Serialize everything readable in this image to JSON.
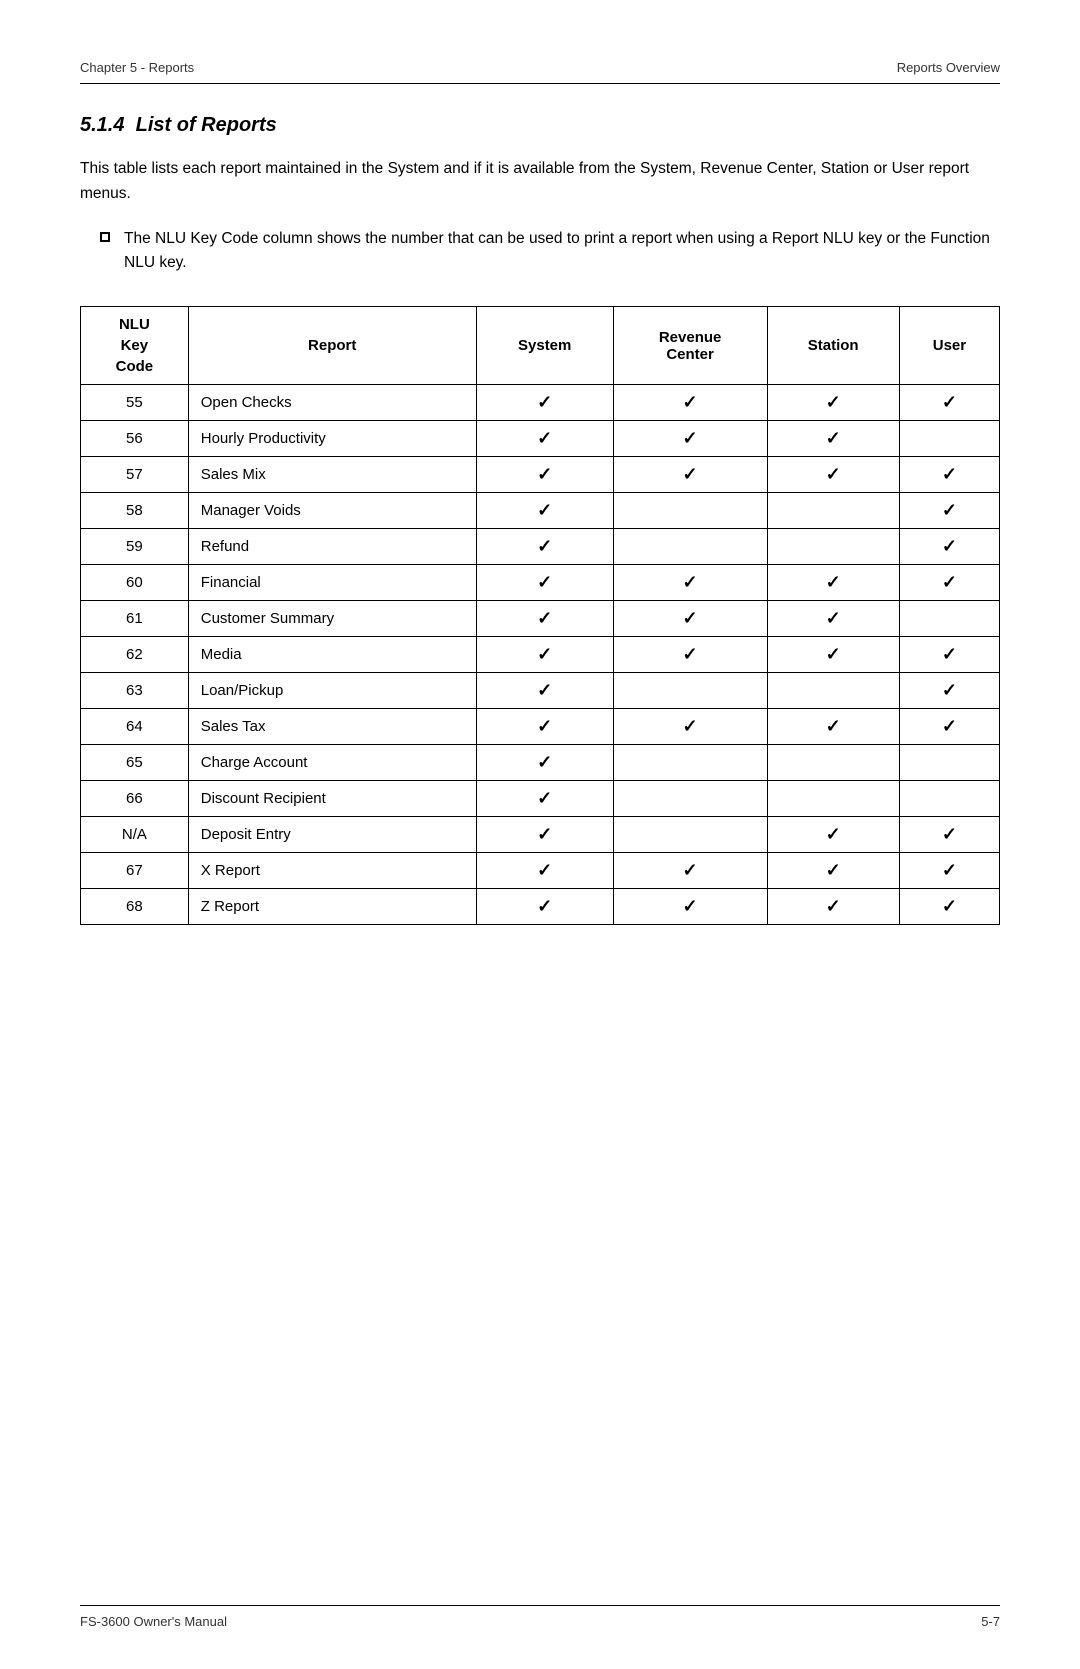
{
  "header": {
    "left": "Chapter 5 - Reports",
    "right": "Reports Overview"
  },
  "section": {
    "number": "5.1.4",
    "title": "List of Reports"
  },
  "body_paragraph": "This table lists each report maintained in the System and if it is available from the System, Revenue Center, Station or User report menus.",
  "bullet_item": "The NLU Key Code column shows the number that can be used to print a report when using a Report NLU key or the Function NLU key.",
  "table": {
    "headers": {
      "nlu_key_code": [
        "NLU",
        "Key",
        "Code"
      ],
      "report": "Report",
      "system": "System",
      "revenue_center": "Revenue Center",
      "station": "Station",
      "user": "User"
    },
    "rows": [
      {
        "code": "55",
        "report": "Open Checks",
        "system": true,
        "revenue": true,
        "station": true,
        "user": true
      },
      {
        "code": "56",
        "report": "Hourly Productivity",
        "system": true,
        "revenue": true,
        "station": true,
        "user": false
      },
      {
        "code": "57",
        "report": "Sales Mix",
        "system": true,
        "revenue": true,
        "station": true,
        "user": true
      },
      {
        "code": "58",
        "report": "Manager Voids",
        "system": true,
        "revenue": false,
        "station": false,
        "user": true
      },
      {
        "code": "59",
        "report": "Refund",
        "system": true,
        "revenue": false,
        "station": false,
        "user": true
      },
      {
        "code": "60",
        "report": "Financial",
        "system": true,
        "revenue": true,
        "station": true,
        "user": true
      },
      {
        "code": "61",
        "report": "Customer Summary",
        "system": true,
        "revenue": true,
        "station": true,
        "user": false
      },
      {
        "code": "62",
        "report": "Media",
        "system": true,
        "revenue": true,
        "station": true,
        "user": true
      },
      {
        "code": "63",
        "report": "Loan/Pickup",
        "system": true,
        "revenue": false,
        "station": false,
        "user": true
      },
      {
        "code": "64",
        "report": "Sales Tax",
        "system": true,
        "revenue": true,
        "station": true,
        "user": true
      },
      {
        "code": "65",
        "report": "Charge Account",
        "system": true,
        "revenue": false,
        "station": false,
        "user": false
      },
      {
        "code": "66",
        "report": "Discount Recipient",
        "system": true,
        "revenue": false,
        "station": false,
        "user": false
      },
      {
        "code": "N/A",
        "report": "Deposit Entry",
        "system": true,
        "revenue": false,
        "station": true,
        "user": true
      },
      {
        "code": "67",
        "report": "X Report",
        "system": true,
        "revenue": true,
        "station": true,
        "user": true
      },
      {
        "code": "68",
        "report": "Z Report",
        "system": true,
        "revenue": true,
        "station": true,
        "user": true
      }
    ]
  },
  "footer": {
    "left": "FS-3600 Owner's Manual",
    "right": "5-7"
  },
  "checkmark_char": "✓"
}
